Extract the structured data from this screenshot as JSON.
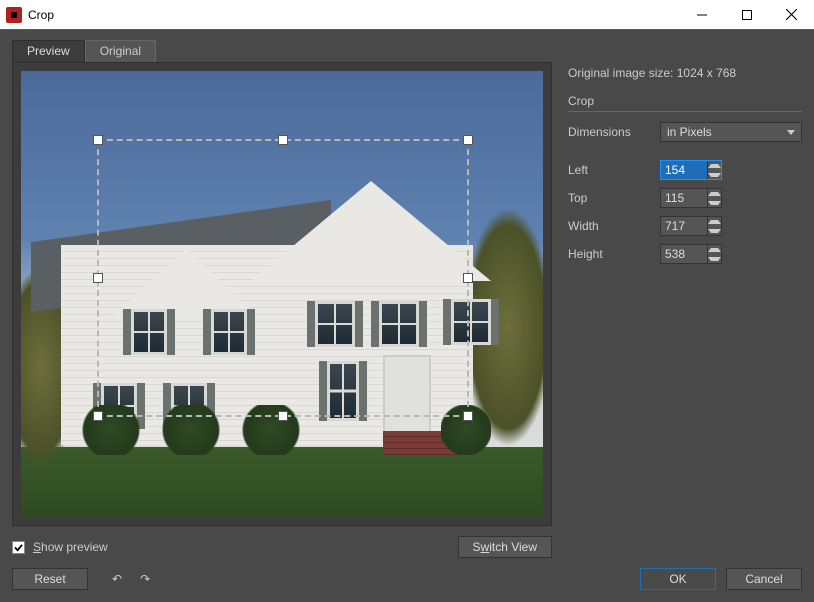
{
  "window": {
    "title": "Crop"
  },
  "tabs": {
    "preview": "Preview",
    "original": "Original",
    "active": "preview"
  },
  "controls": {
    "show_preview_label": "Show preview",
    "show_preview_checked": true,
    "switch_view": "Switch View",
    "reset": "Reset",
    "ok": "OK",
    "cancel": "Cancel"
  },
  "panel": {
    "original_size_label": "Original image size:",
    "original_size_value": "1024 x 768",
    "section_crop": "Crop",
    "dimensions_label": "Dimensions",
    "dimensions_value": "in Pixels",
    "fields": {
      "left": {
        "label": "Left",
        "value": "154",
        "active": true
      },
      "top": {
        "label": "Top",
        "value": "115"
      },
      "width": {
        "label": "Width",
        "value": "717"
      },
      "height": {
        "label": "Height",
        "value": "538"
      }
    }
  }
}
